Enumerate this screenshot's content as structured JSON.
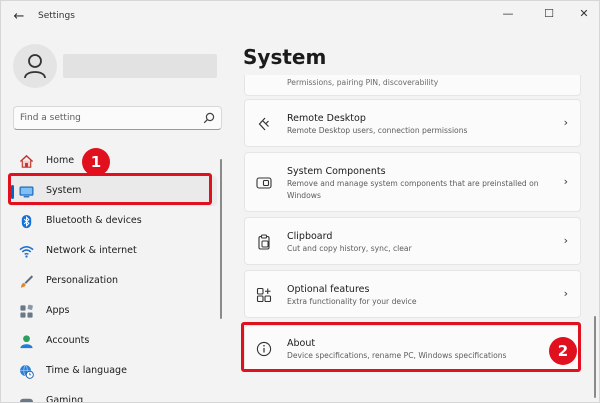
{
  "window": {
    "title": "Settings"
  },
  "titlebar": {
    "back_glyph": "←",
    "minimize_glyph": "—",
    "maximize_glyph": "☐",
    "close_glyph": "✕"
  },
  "search": {
    "placeholder": "Find a setting"
  },
  "sidebar": {
    "items": [
      {
        "label": "Home",
        "icon": "home-icon"
      },
      {
        "label": "System",
        "icon": "system-display-icon",
        "selected": true
      },
      {
        "label": "Bluetooth & devices",
        "icon": "bluetooth-icon"
      },
      {
        "label": "Network & internet",
        "icon": "wifi-icon"
      },
      {
        "label": "Personalization",
        "icon": "paintbrush-icon"
      },
      {
        "label": "Apps",
        "icon": "apps-icon"
      },
      {
        "label": "Accounts",
        "icon": "accounts-icon"
      },
      {
        "label": "Time & language",
        "icon": "globe-clock-icon"
      },
      {
        "label": "Gaming",
        "icon": "gaming-icon"
      }
    ]
  },
  "main": {
    "title": "System",
    "partial_card_text": "Permissions, pairing PIN, discoverability",
    "cards": [
      {
        "title": "Remote Desktop",
        "subtitle": "Remote Desktop users, connection permissions",
        "icon": "remote-desktop-icon"
      },
      {
        "title": "System Components",
        "subtitle": "Remove and manage system components that are preinstalled on Windows",
        "icon": "system-components-icon"
      },
      {
        "title": "Clipboard",
        "subtitle": "Cut and copy history, sync, clear",
        "icon": "clipboard-icon"
      },
      {
        "title": "Optional features",
        "subtitle": "Extra functionality for your device",
        "icon": "optional-features-icon"
      },
      {
        "title": "About",
        "subtitle": "Device specifications, rename PC, Windows specifications",
        "icon": "info-icon"
      }
    ],
    "chevron": "›"
  },
  "annotations": {
    "badge_1": "1",
    "badge_2": "2",
    "highlight_color": "#e0101e"
  },
  "colors": {
    "accent": "#0067c0",
    "background": "#f3f3f3",
    "card": "#fbfbfb"
  }
}
